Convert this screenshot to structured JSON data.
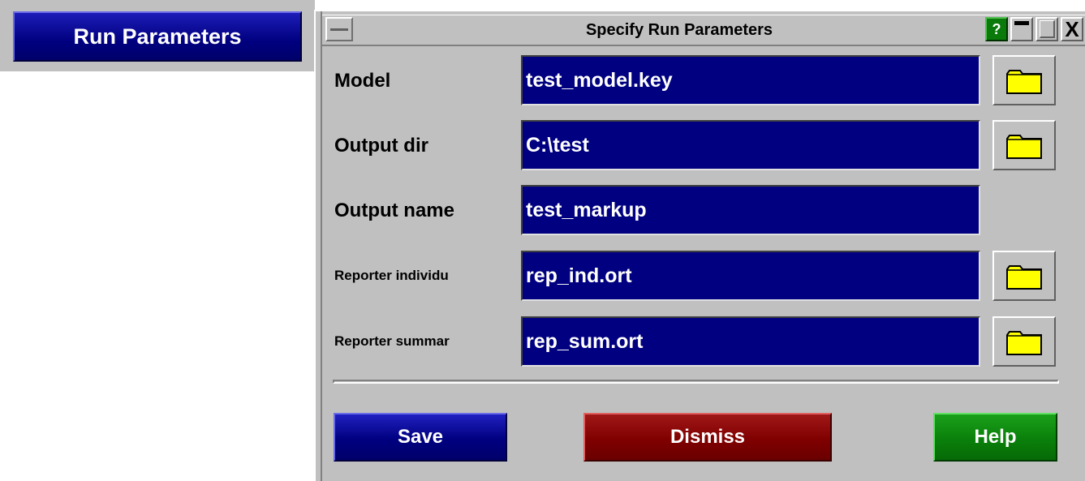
{
  "launcher": {
    "label": "Run Parameters"
  },
  "dialog": {
    "title": "Specify Run Parameters",
    "title_buttons": {
      "help": "?",
      "close": "X"
    },
    "rows": [
      {
        "label": "Model",
        "value": "test_model.key",
        "browse": true
      },
      {
        "label": "Output dir",
        "value": "C:\\test",
        "browse": true
      },
      {
        "label": "Output name",
        "value": "test_markup",
        "browse": false
      },
      {
        "label": "Reporter individu",
        "value": "rep_ind.ort",
        "browse": true
      },
      {
        "label": "Reporter summar",
        "value": "rep_sum.ort",
        "browse": true
      }
    ],
    "actions": {
      "save": "Save",
      "dismiss": "Dismiss",
      "help": "Help"
    }
  },
  "colors": {
    "field_bg": "#000080",
    "panel_bg": "#c0c0c0",
    "folder": "#ffff00",
    "save": "#000080",
    "dismiss": "#800000",
    "help": "#0a800a"
  },
  "icons": {
    "browse": "folder-icon",
    "menu": "window-menu-icon",
    "minimize": "minimize-icon",
    "maximize": "maximize-icon",
    "close": "close-icon"
  }
}
